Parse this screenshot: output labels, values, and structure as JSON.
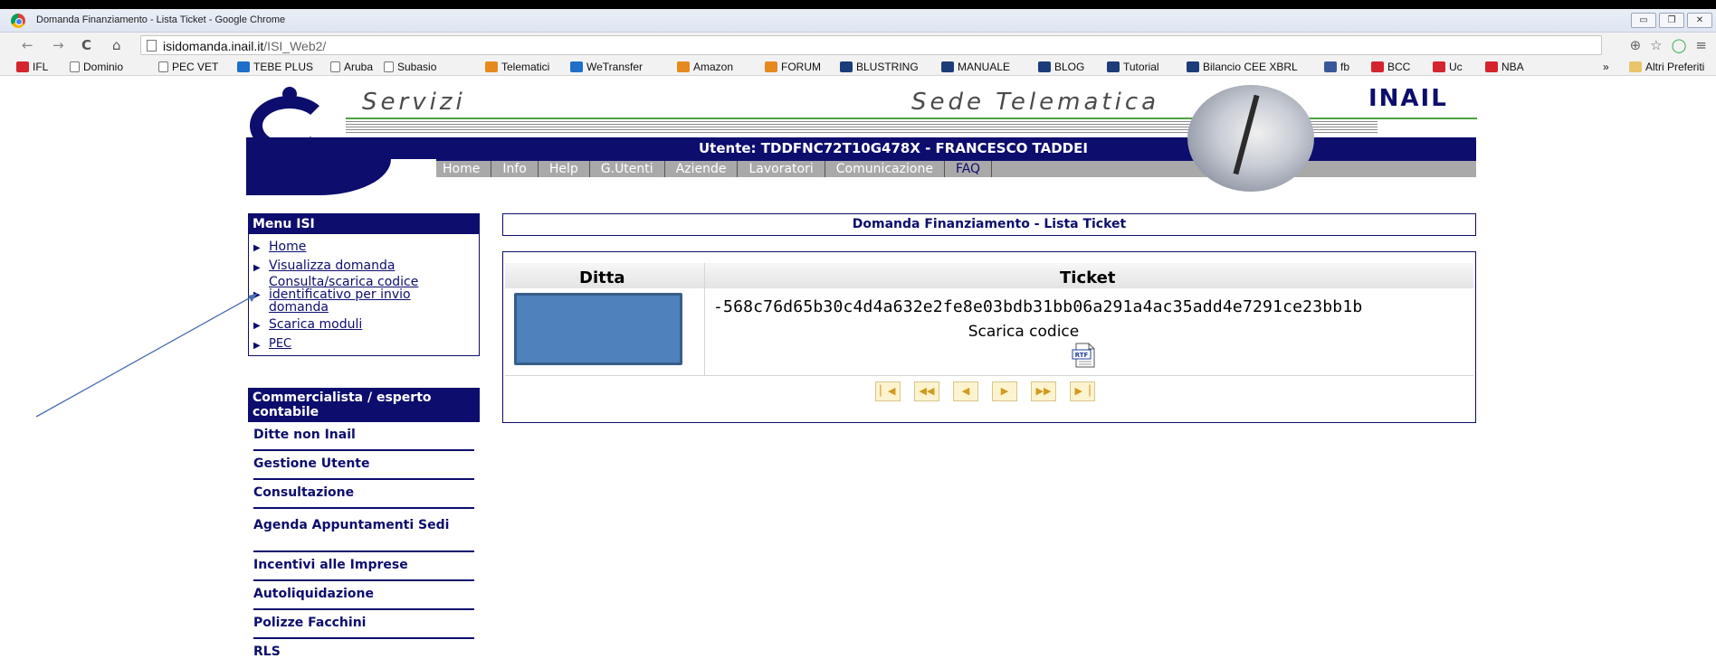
{
  "window": {
    "title": "Domanda Finanziamento - Lista Ticket - Google Chrome",
    "url_host": "isidomanda.inail.it",
    "url_path": "/ISI_Web2/"
  },
  "bookmarks": [
    {
      "label": "IFL",
      "icon": "ic-red"
    },
    {
      "label": "Dominio",
      "icon": "ic-page"
    },
    {
      "label": "PEC VET",
      "icon": "ic-page"
    },
    {
      "label": "TEBE PLUS",
      "icon": "ic-blue"
    },
    {
      "label": "Aruba",
      "icon": "ic-page"
    },
    {
      "label": "Subasio",
      "icon": "ic-page"
    },
    {
      "label": "Telematici",
      "icon": "ic-orange"
    },
    {
      "label": "WeTransfer",
      "icon": "ic-blue"
    },
    {
      "label": "Amazon",
      "icon": "ic-orange"
    },
    {
      "label": "FORUM",
      "icon": "ic-orange"
    },
    {
      "label": "BLUSTRING",
      "icon": "ic-nav"
    },
    {
      "label": "MANUALE",
      "icon": "ic-nav"
    },
    {
      "label": "BLOG",
      "icon": "ic-nav"
    },
    {
      "label": "Tutorial",
      "icon": "ic-nav"
    },
    {
      "label": "Bilancio CEE XBRL",
      "icon": "ic-nav"
    },
    {
      "label": "fb",
      "icon": "ic-fb"
    },
    {
      "label": "BCC",
      "icon": "ic-red"
    },
    {
      "label": "Uc",
      "icon": "ic-red"
    },
    {
      "label": "NBA",
      "icon": "ic-red"
    }
  ],
  "bookmarks_more": "»",
  "bookmarks_other": "Altri Preferiti",
  "header": {
    "servizi": "Servizi",
    "sede": "Sede Telematica",
    "brand": "INAIL",
    "utente": "Utente: TDDFNC72T10G478X - FRANCESCO TADDEI",
    "nav": [
      "Home",
      "Info",
      "Help",
      "G.Utenti",
      "Aziende",
      "Lavoratori",
      "Comunicazione",
      "FAQ"
    ]
  },
  "menu_isi": {
    "title": "Menu ISI",
    "home": "Home",
    "visualizza": "Visualizza domanda",
    "consulta_line1": "Consulta/scarica codice",
    "consulta_line2": "identificativo per invio",
    "consulta_line3": "domanda",
    "scarica_moduli": "Scarica moduli",
    "pec": "PEC"
  },
  "professional_menu": {
    "title": "Commercialista / esperto contabile",
    "items": [
      "Ditte non Inail",
      "Gestione Utente",
      "Consultazione",
      "Agenda Appuntamenti Sedi",
      "Incentivi alle Imprese",
      "Autoliquidazione",
      "Polizze Facchini",
      "RLS"
    ]
  },
  "main": {
    "title": "Domanda Finanziamento - Lista Ticket",
    "col_ditta": "Ditta",
    "col_ticket": "Ticket",
    "ticket_code": "-568c76d65b30c4d4a632e2fe8e03bdb31bb06a291a4ac35add4e7291ce23bb1b",
    "scarica_codice": "Scarica codice",
    "rtf_label": "RTF"
  },
  "colors": {
    "brand_navy": "#0d0d6e",
    "redacted_box": "#4f81bd",
    "pager_gold": "#d29a1f"
  }
}
